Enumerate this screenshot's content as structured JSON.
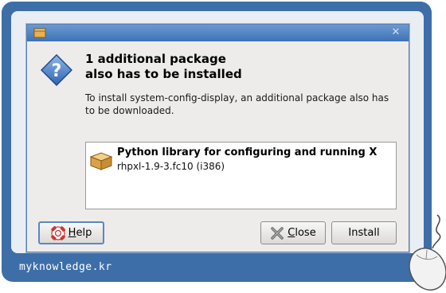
{
  "dialog": {
    "headline_line1": "1 additional package",
    "headline_line2": "also has to be installed",
    "description": "To install system-config-display, an additional package also has to be downloaded.",
    "package": {
      "name": "Python library for configuring and running X",
      "version": "rhpxl-1.9-3.fc10 (i386)"
    },
    "buttons": {
      "help_prefix": "",
      "help_mnemonic": "H",
      "help_rest": "elp",
      "close_mnemonic": "C",
      "close_rest": "lose",
      "install": "Install"
    }
  },
  "watermark": "myknowledge.kr",
  "icons": {
    "title": "package-icon",
    "question": "question-icon",
    "package": "package-box-icon",
    "help": "lifebuoy-icon",
    "close": "close-x-icon",
    "mouse": "mouse-icon"
  },
  "colors": {
    "frame": "#3d6ea8",
    "titlebar": "#4f82c2",
    "dialog_bg": "#edeceb"
  }
}
